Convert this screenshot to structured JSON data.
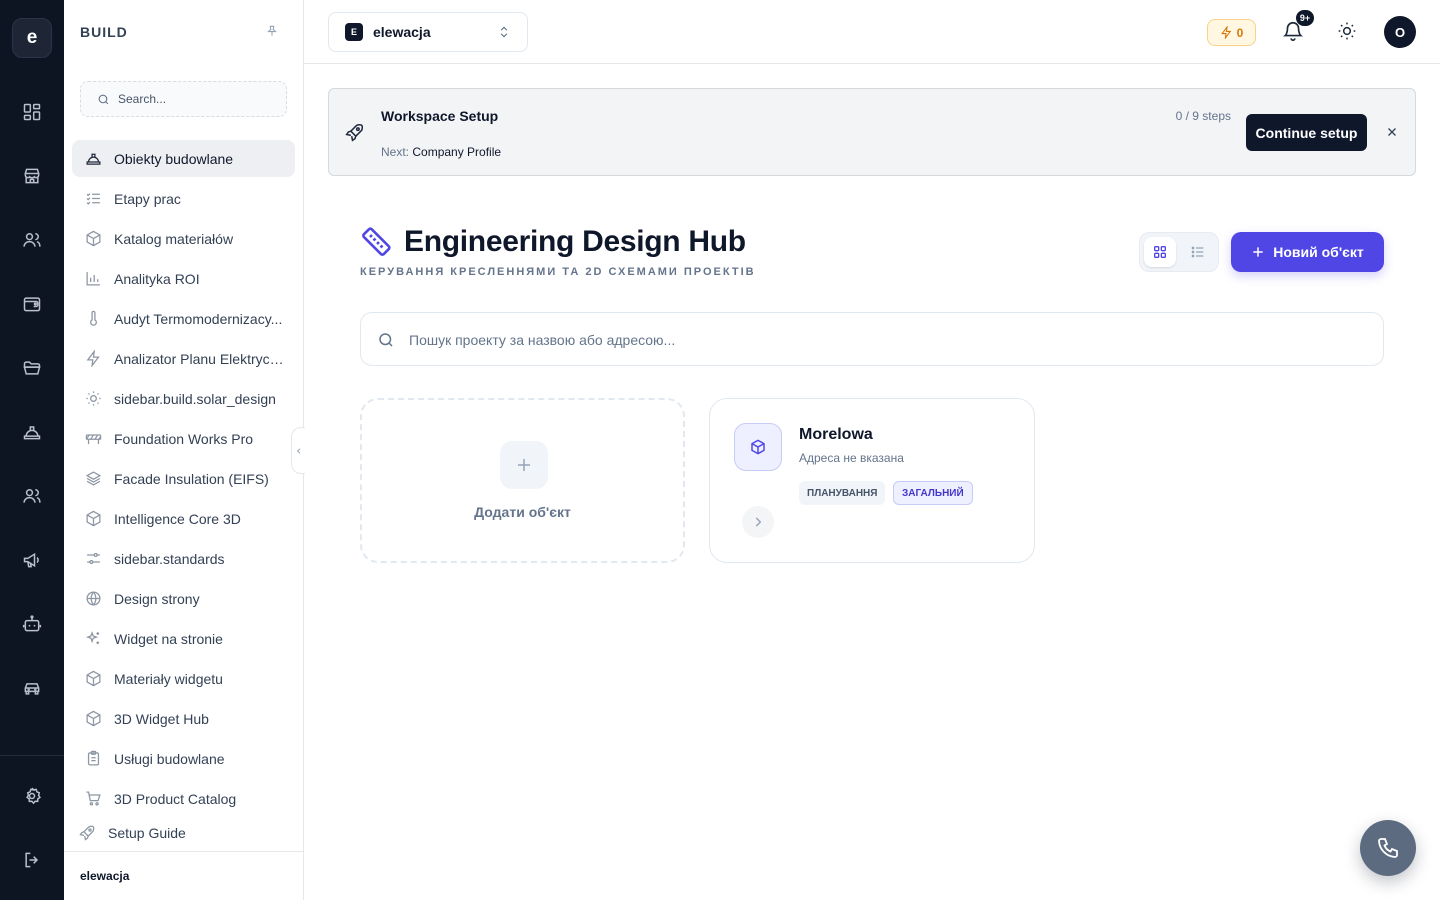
{
  "rail": {
    "logo": "e",
    "icons": [
      "dashboard-icon",
      "store-icon",
      "users-icon",
      "wallet-icon",
      "folder-icon",
      "construction-hat-icon",
      "team-icon",
      "megaphone-icon",
      "bot-icon",
      "car-icon",
      "settings-icon",
      "logout-icon"
    ]
  },
  "sidebar": {
    "header": "BUILD",
    "search_placeholder": "Search...",
    "items": [
      {
        "label": "Obiekty budowlane",
        "icon": "hard-hat-icon",
        "active": true
      },
      {
        "label": "Etapy prac",
        "icon": "checklist-icon"
      },
      {
        "label": "Katalog materiałów",
        "icon": "package-icon"
      },
      {
        "label": "Analityka ROI",
        "icon": "bar-chart-icon"
      },
      {
        "label": "Audyt Termomodernizacy...",
        "icon": "thermometer-icon"
      },
      {
        "label": "Analizator Planu Elektrycz...",
        "icon": "lightning-icon"
      },
      {
        "label": "sidebar.build.solar_design",
        "icon": "sun-icon"
      },
      {
        "label": "Foundation Works Pro",
        "icon": "barrier-icon"
      },
      {
        "label": "Facade Insulation (EIFS)",
        "icon": "layers-icon"
      },
      {
        "label": "Intelligence Core 3D",
        "icon": "cube-icon"
      },
      {
        "label": "sidebar.standards",
        "icon": "sliders-icon"
      },
      {
        "label": "Design strony",
        "icon": "globe-icon"
      },
      {
        "label": "Widget na stronie",
        "icon": "sparkles-icon"
      },
      {
        "label": "Materiały widgetu",
        "icon": "cube-icon"
      },
      {
        "label": "3D Widget Hub",
        "icon": "cube-icon"
      },
      {
        "label": "Usługi budowlane",
        "icon": "clipboard-icon"
      },
      {
        "label": "3D Product Catalog",
        "icon": "cart-icon"
      }
    ],
    "setup_guide": "Setup Guide",
    "footer": "elewacja"
  },
  "topbar": {
    "workspace_badge": "E",
    "workspace": "elewacja",
    "credits": "0",
    "notifications_badge": "9+",
    "avatar": "O"
  },
  "banner": {
    "title": "Workspace Setup",
    "next_label": "Next:",
    "next_value": "Company Profile",
    "steps": "0 / 9 steps",
    "button": "Continue setup"
  },
  "hub": {
    "title": "Engineering Design Hub",
    "subtitle": "КЕРУВАННЯ КРЕСЛЕННЯМИ ТА 2D СХЕМАМИ ПРОЕКТІВ",
    "new_button": "Новий об'єкт",
    "search_placeholder": "Пошук проекту за назвою або адресою...",
    "view_mode": "grid"
  },
  "cards": {
    "add_label": "Додати об'єкт",
    "projects": [
      {
        "name": "Morelowa",
        "address": "Адреса не вказана",
        "tags": [
          "ПЛАНУВАННЯ",
          "ЗАГАЛЬНИЙ"
        ]
      }
    ]
  },
  "colors": {
    "accent": "#4f46e5",
    "rail_bg": "#0d1422",
    "credits": "#d97706"
  }
}
